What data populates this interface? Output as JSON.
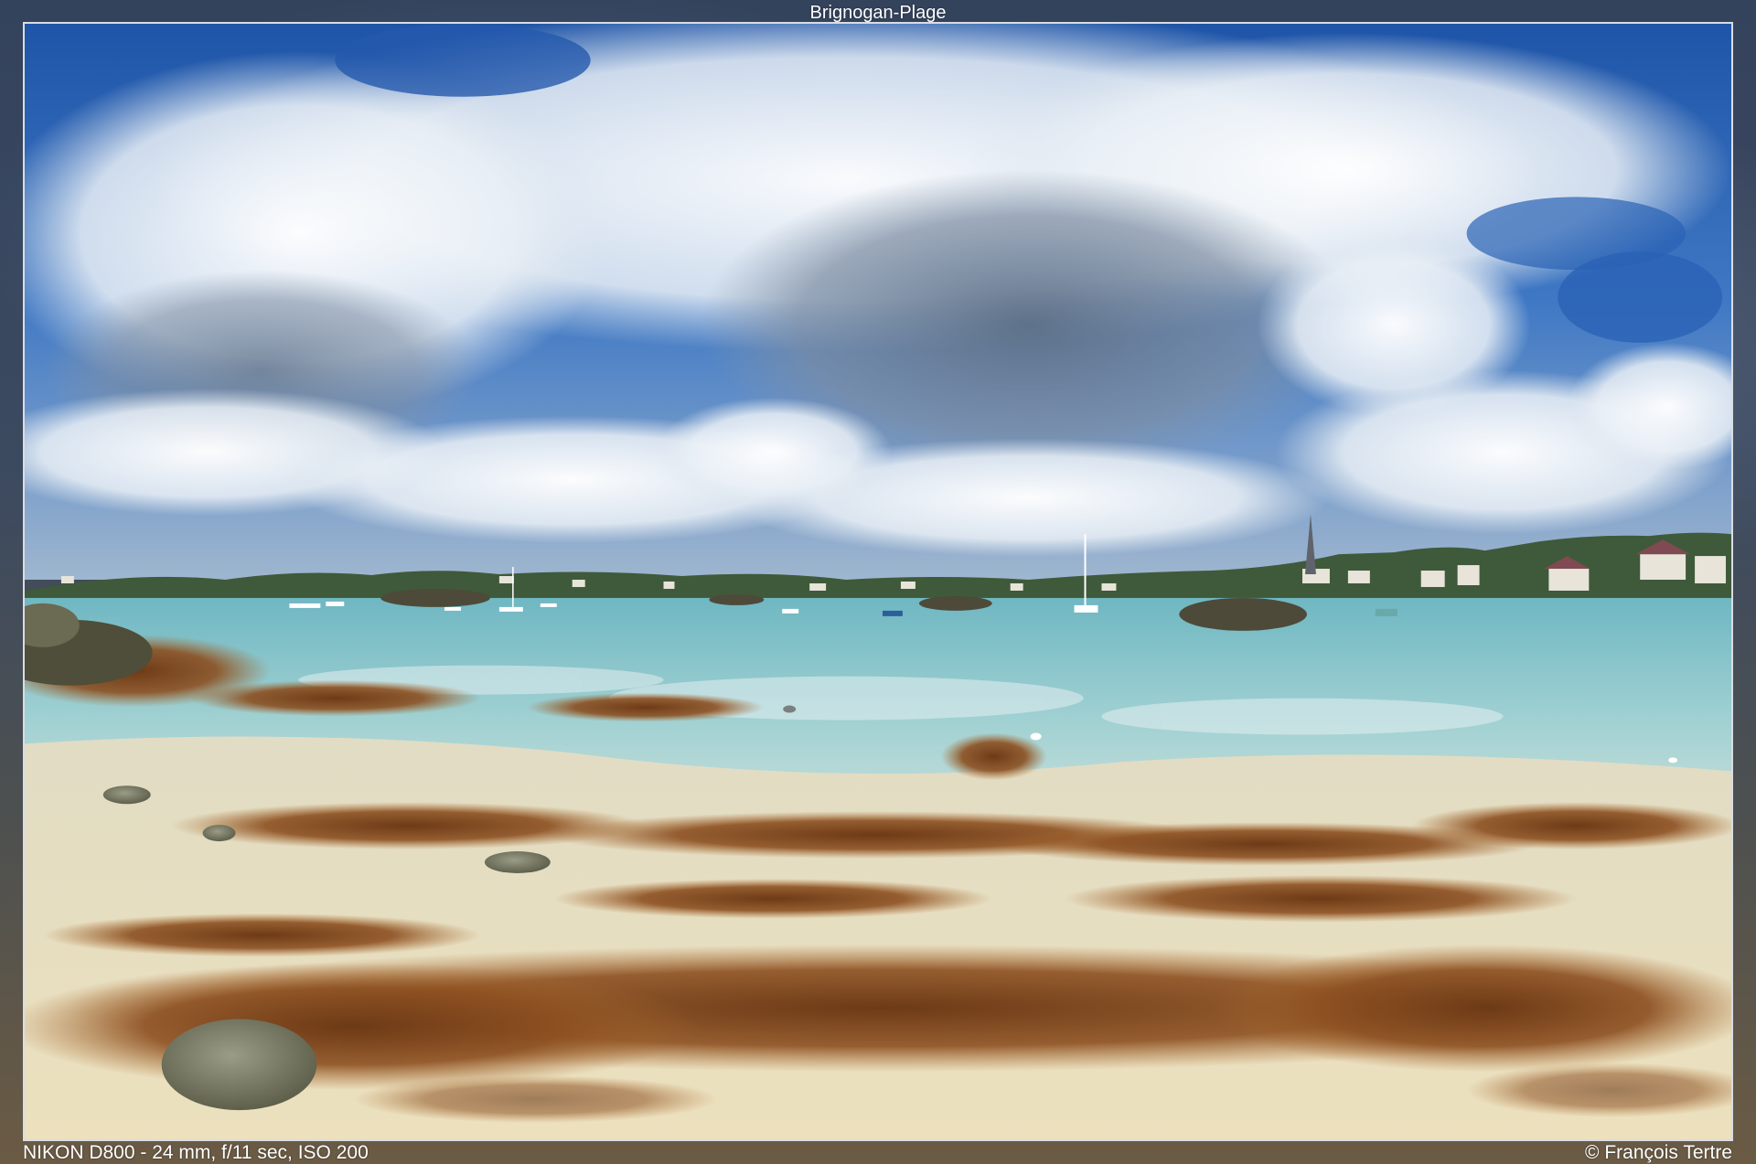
{
  "title": "Brignogan-Plage",
  "exif": "NIKON D800 - 24 mm, f/11 sec, ISO 200",
  "credit": "© François Tertre",
  "colors": {
    "sky_blue": "#2a62b5",
    "cloud_white": "#eef2f6",
    "water": "#86c6cc",
    "sand": "#e6dcbc",
    "seaweed": "#8a4d1e"
  }
}
